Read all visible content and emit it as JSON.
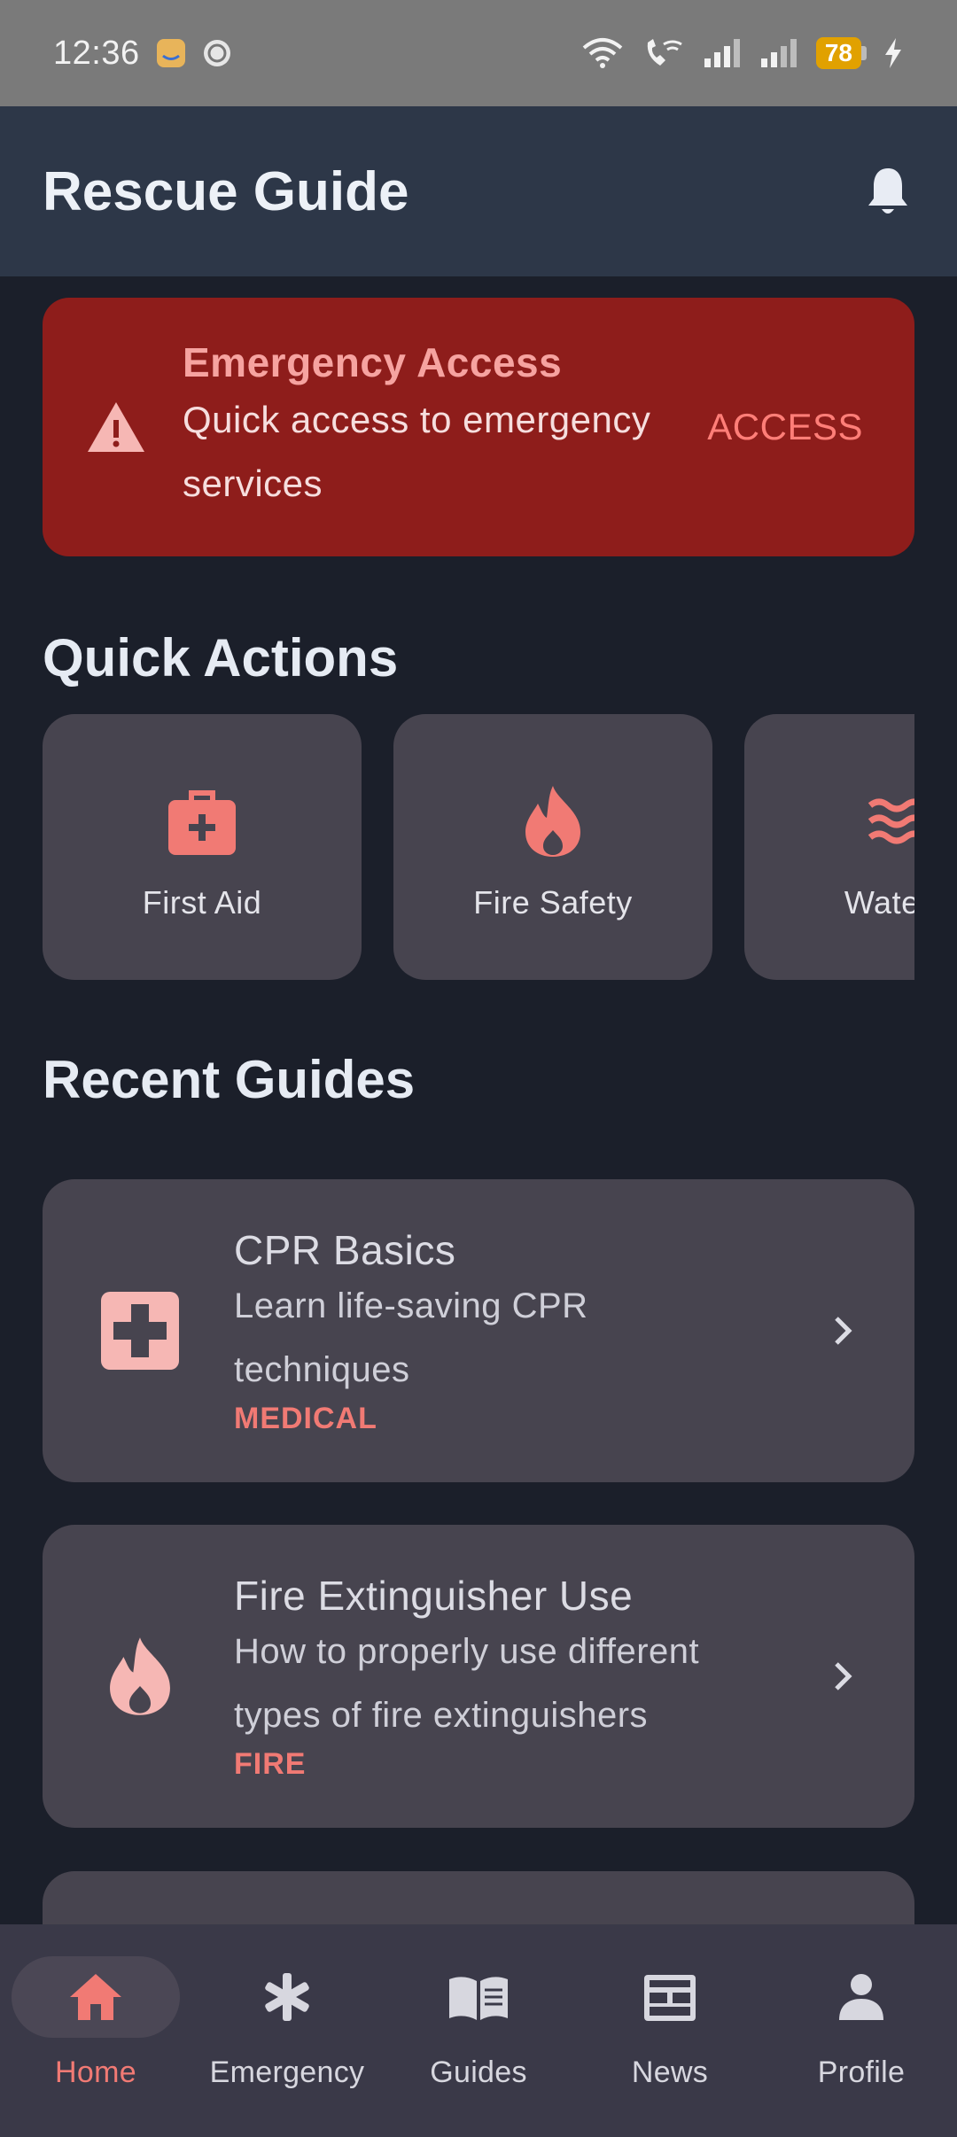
{
  "status_bar": {
    "time": "12:36",
    "battery": "78"
  },
  "app_bar": {
    "title": "Rescue Guide"
  },
  "emergency": {
    "title": "Emergency Access",
    "description": "Quick access to emergency services",
    "action": "ACCESS"
  },
  "quick_actions": {
    "title": "Quick Actions",
    "items": [
      {
        "label": "First Aid",
        "icon": "medical-kit-icon"
      },
      {
        "label": "Fire Safety",
        "icon": "flame-icon"
      },
      {
        "label": "Water R",
        "icon": "waves-icon"
      }
    ]
  },
  "recent_guides": {
    "title": "Recent Guides",
    "items": [
      {
        "title": "CPR Basics",
        "description": "Learn life-saving CPR techniques",
        "tag": "MEDICAL",
        "icon": "medical-cross-icon"
      },
      {
        "title": "Fire Extinguisher Use",
        "description": "How to properly use different types of fire extinguishers",
        "tag": "FIRE",
        "icon": "flame-icon"
      }
    ]
  },
  "bottom_nav": {
    "items": [
      {
        "label": "Home",
        "icon": "home-icon",
        "active": true
      },
      {
        "label": "Emergency",
        "icon": "asterisk-icon"
      },
      {
        "label": "Guides",
        "icon": "book-icon"
      },
      {
        "label": "News",
        "icon": "newspaper-icon"
      },
      {
        "label": "Profile",
        "icon": "person-icon"
      }
    ]
  },
  "colors": {
    "background": "#1b1f2a",
    "app_bar": "#2d3748",
    "emergency_banner": "#8e1d1b",
    "card": "#47444f",
    "accent": "#f17a74"
  }
}
